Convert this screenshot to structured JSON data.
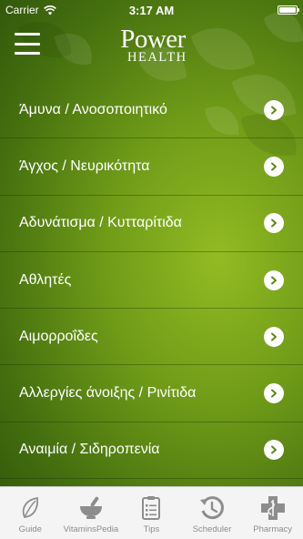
{
  "status_bar": {
    "carrier": "Carrier",
    "time": "3:17 AM",
    "battery_level": 1.0
  },
  "header": {
    "menu_icon": "hamburger-menu-icon",
    "logo_line1": "Power",
    "logo_line2": "HEALTH"
  },
  "menu": {
    "items": [
      {
        "label": "Άμυνα / Ανοσοποιητικό"
      },
      {
        "label": "Άγχος / Νευρικότητα"
      },
      {
        "label": "Αδυνάτισμα / Κυτταρίτιδα"
      },
      {
        "label": "Αθλητές"
      },
      {
        "label": "Αιμορροΐδες"
      },
      {
        "label": "Αλλεργίες άνοιξης / Ρινίτιδα"
      },
      {
        "label": "Αναιμία / Σιδηροπενία"
      }
    ]
  },
  "tab_bar": {
    "tabs": [
      {
        "label": "Guide",
        "icon": "leaf-icon"
      },
      {
        "label": "VitaminsPedia",
        "icon": "mortar-pestle-icon"
      },
      {
        "label": "Tips",
        "icon": "clipboard-list-icon"
      },
      {
        "label": "Scheduler",
        "icon": "clock-history-icon"
      },
      {
        "label": "Pharmacy",
        "icon": "pharmacy-cross-icon"
      }
    ]
  },
  "colors": {
    "background_center": "#93bb22",
    "background_edge": "#2f540b",
    "tab_bar_bg": "#f4f4f4",
    "tab_icon": "#8d8d8d",
    "chevron_arrow": "#5a8a14"
  }
}
